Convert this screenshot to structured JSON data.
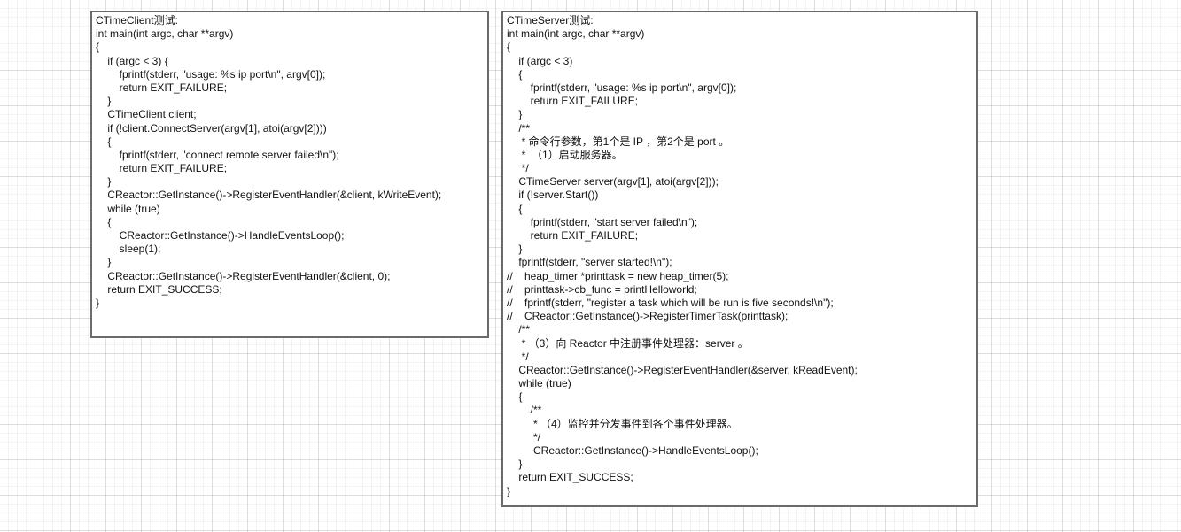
{
  "client_box": {
    "lines": [
      "CTimeClient测试:",
      "int main(int argc, char **argv)",
      "{",
      "    if (argc < 3) {",
      "        fprintf(stderr, \"usage: %s ip port\\n\", argv[0]);",
      "        return EXIT_FAILURE;",
      "    }",
      "    CTimeClient client;",
      "    if (!client.ConnectServer(argv[1], atoi(argv[2])))",
      "    {",
      "        fprintf(stderr, \"connect remote server failed\\n\");",
      "        return EXIT_FAILURE;",
      "    }",
      "    CReactor::GetInstance()->RegisterEventHandler(&client, kWriteEvent);",
      "    while (true)",
      "    {",
      "        CReactor::GetInstance()->HandleEventsLoop();",
      "        sleep(1);",
      "    }",
      "    CReactor::GetInstance()->RegisterEventHandler(&client, 0);",
      "    return EXIT_SUCCESS;",
      "}"
    ]
  },
  "server_box": {
    "lines": [
      "CTimeServer测试:",
      "int main(int argc, char **argv)",
      "{",
      "    if (argc < 3)",
      "    {",
      "        fprintf(stderr, \"usage: %s ip port\\n\", argv[0]);",
      "        return EXIT_FAILURE;",
      "    }",
      "    /**",
      "     * 命令行参数，第1个是 IP ，第2个是 port 。",
      "     *  （1）启动服务器。",
      "     */",
      "    CTimeServer server(argv[1], atoi(argv[2]));",
      "    if (!server.Start())",
      "    {",
      "        fprintf(stderr, \"start server failed\\n\");",
      "        return EXIT_FAILURE;",
      "    }",
      "    fprintf(stderr, \"server started!\\n\");",
      "//    heap_timer *printtask = new heap_timer(5);",
      "//    printtask->cb_func = printHelloworld;",
      "//    fprintf(stderr, \"register a task which will be run is five seconds!\\n\");",
      "//    CReactor::GetInstance()->RegisterTimerTask(printtask);",
      "    /**",
      "     * （3）向 Reactor 中注册事件处理器：server 。",
      "     */",
      "    CReactor::GetInstance()->RegisterEventHandler(&server, kReadEvent);",
      "    while (true)",
      "    {",
      "        /**",
      "         * （4）监控并分发事件到各个事件处理器。",
      "         */",
      "         CReactor::GetInstance()->HandleEventsLoop();",
      "    }",
      "    return EXIT_SUCCESS;",
      "}"
    ]
  },
  "colors": {
    "border": "#6b6b6b",
    "text": "#111111",
    "background": "#ffffff",
    "grid": "#e8e8e8"
  }
}
